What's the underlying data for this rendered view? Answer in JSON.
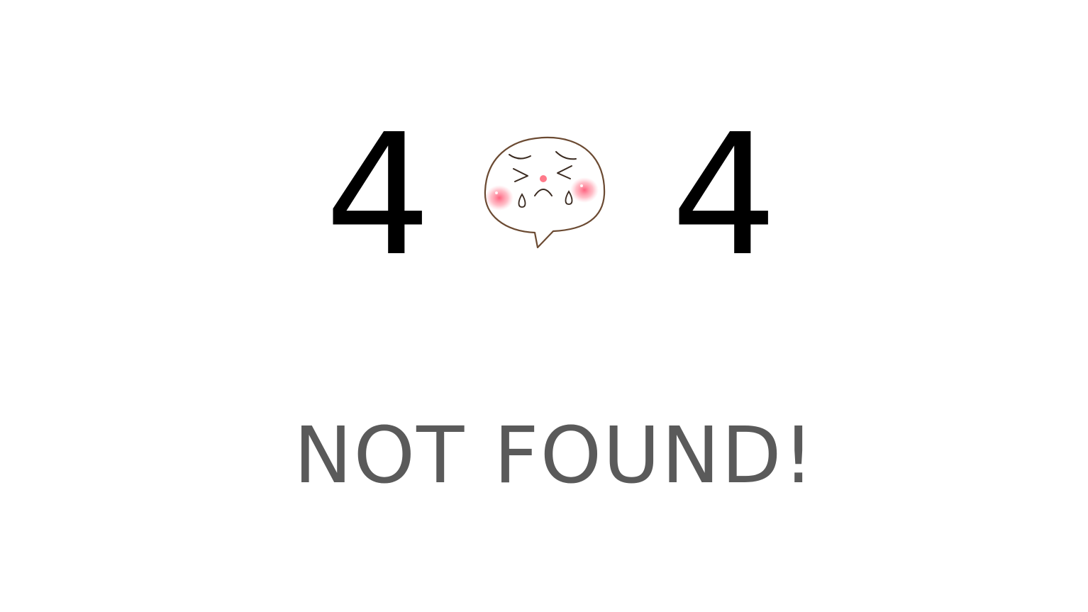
{
  "error": {
    "digit_left": "4",
    "digit_right": "4",
    "mascot_icon": "crying-face-icon",
    "message_words": [
      "NOT",
      "FOUND!"
    ]
  },
  "colors": {
    "background": "#ffffff",
    "digit": "#000000",
    "message": "#5a5a5a",
    "blush": "#ff7a8a",
    "outline": "#6b4a32"
  }
}
